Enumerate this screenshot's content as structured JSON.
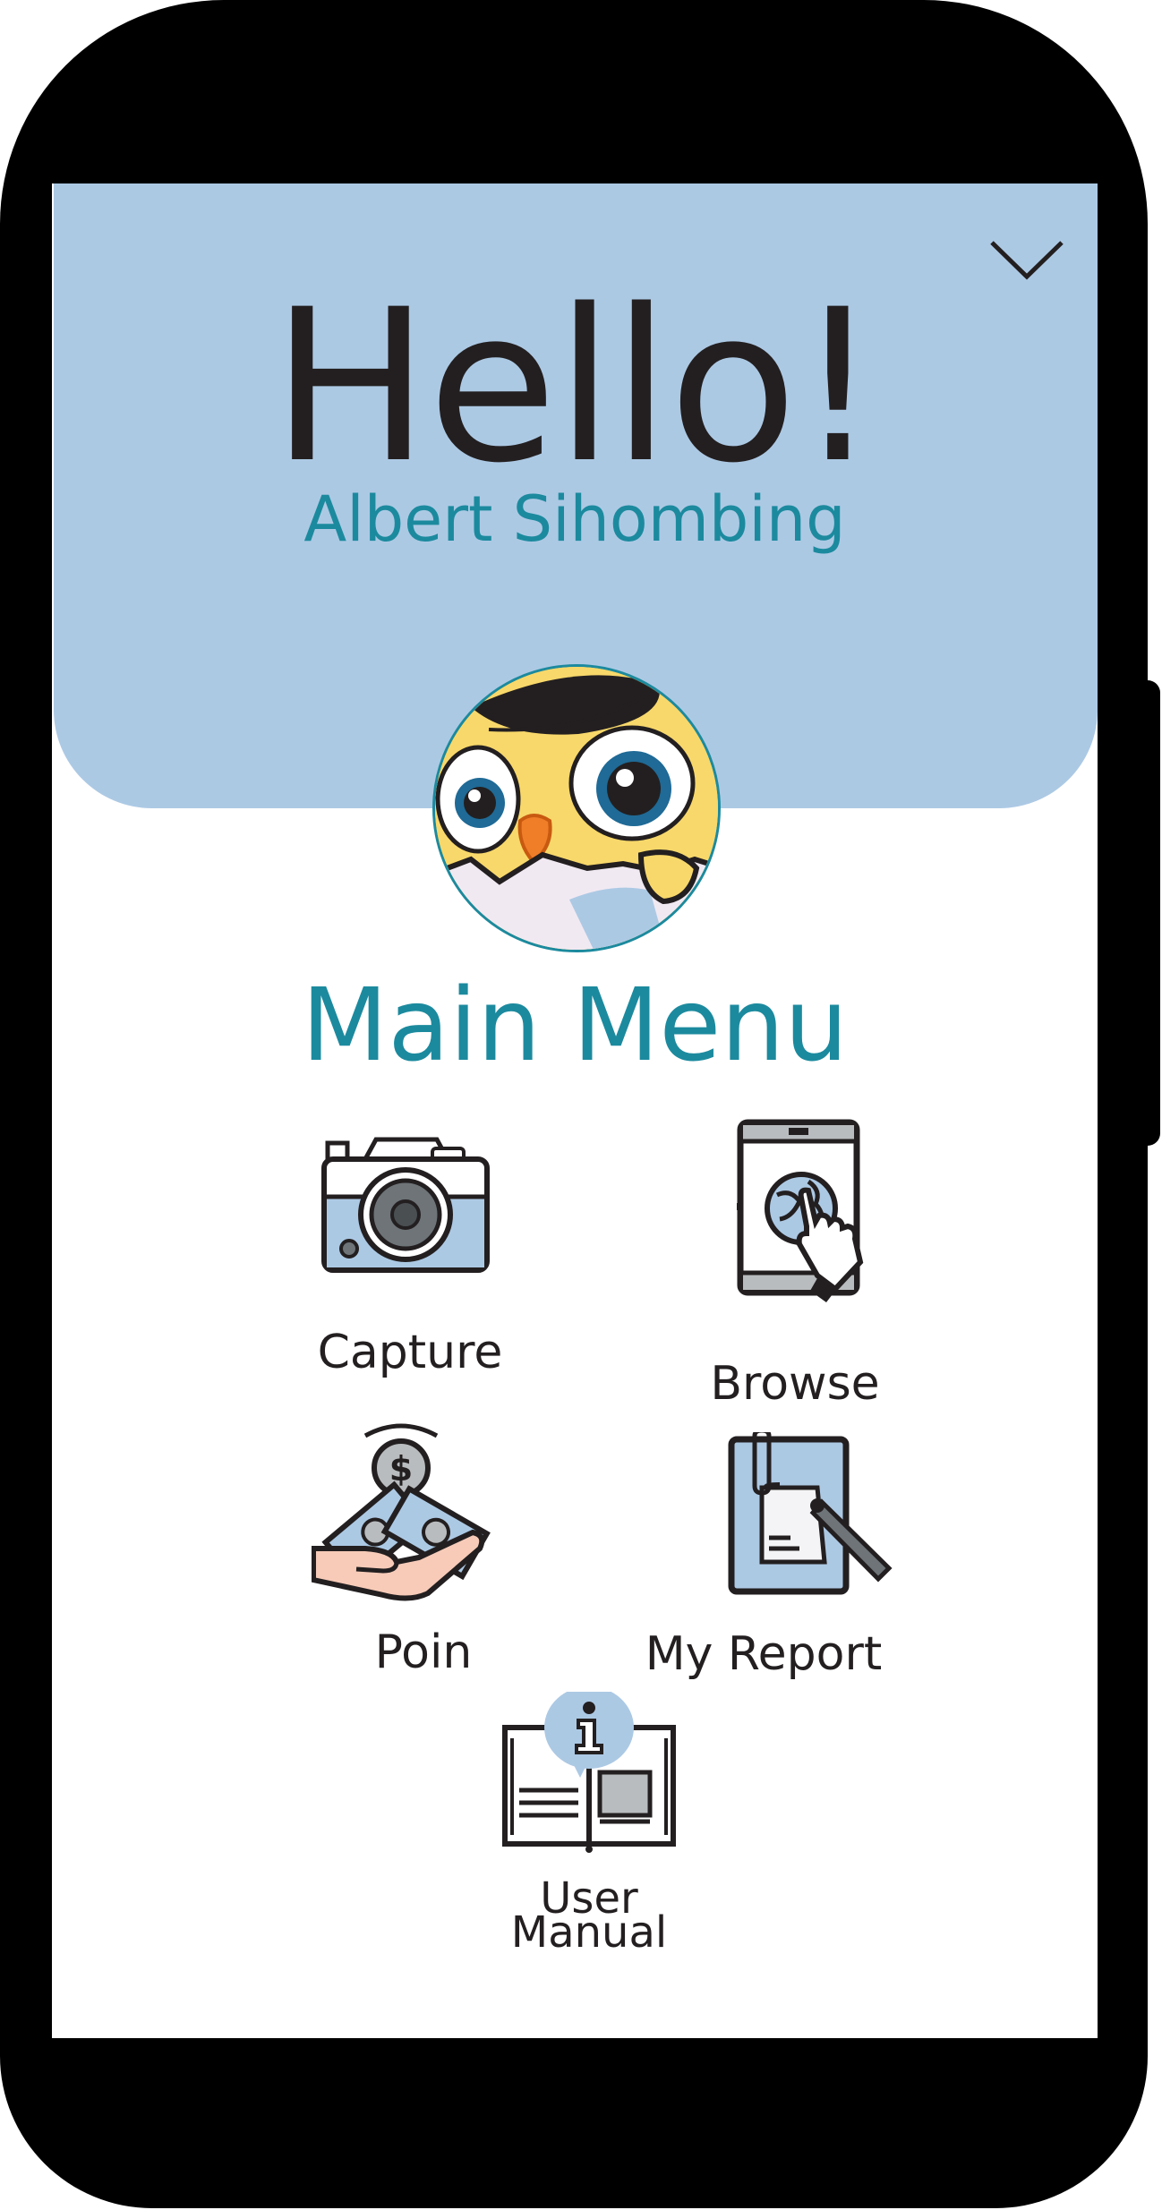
{
  "header": {
    "greeting": "Hello!",
    "user_name": "Albert Sihombing"
  },
  "icons": {
    "collapse": "chevron-down-icon",
    "avatar": "chick-avatar"
  },
  "main_menu": {
    "title": "Main Menu",
    "items": [
      {
        "label": "Capture",
        "icon": "camera-icon"
      },
      {
        "label": "Browse",
        "icon": "tablet-globe-icon"
      },
      {
        "label": "Poin",
        "icon": "money-hand-icon"
      },
      {
        "label": "My Report",
        "icon": "report-clipboard-icon"
      },
      {
        "label_line1": "User",
        "label_line2": "Manual",
        "icon": "manual-book-icon"
      }
    ]
  },
  "colors": {
    "header_bg": "#acc9e4",
    "accent": "#1c8a9e",
    "text_dark": "#231f20",
    "device_frame": "#000000"
  }
}
